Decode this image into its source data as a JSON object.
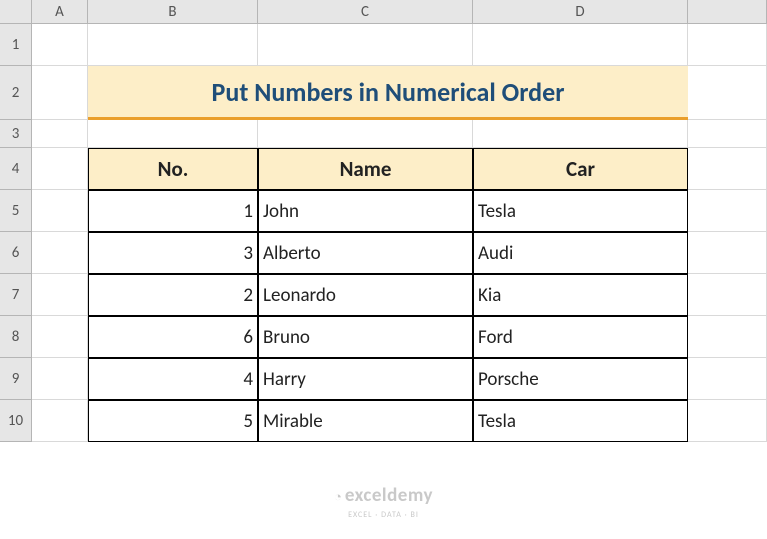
{
  "columns": [
    "A",
    "B",
    "C",
    "D"
  ],
  "rows": [
    "1",
    "2",
    "3",
    "4",
    "5",
    "6",
    "7",
    "8",
    "9",
    "10"
  ],
  "title": "Put Numbers in Numerical Order",
  "headers": {
    "no": "No.",
    "name": "Name",
    "car": "Car"
  },
  "data": [
    {
      "no": "1",
      "name": "John",
      "car": "Tesla"
    },
    {
      "no": "3",
      "name": "Alberto",
      "car": "Audi"
    },
    {
      "no": "2",
      "name": "Leonardo",
      "car": "Kia"
    },
    {
      "no": "6",
      "name": "Bruno",
      "car": "Ford"
    },
    {
      "no": "4",
      "name": "Harry",
      "car": "Porsche"
    },
    {
      "no": "5",
      "name": "Mirable",
      "car": "Tesla"
    }
  ],
  "watermark": {
    "brand": "exceldemy",
    "tag": "EXCEL · DATA · BI"
  },
  "chart_data": {
    "type": "table",
    "title": "Put Numbers in Numerical Order",
    "columns": [
      "No.",
      "Name",
      "Car"
    ],
    "rows": [
      [
        1,
        "John",
        "Tesla"
      ],
      [
        3,
        "Alberto",
        "Audi"
      ],
      [
        2,
        "Leonardo",
        "Kia"
      ],
      [
        6,
        "Bruno",
        "Ford"
      ],
      [
        4,
        "Harry",
        "Porsche"
      ],
      [
        5,
        "Mirable",
        "Tesla"
      ]
    ]
  }
}
